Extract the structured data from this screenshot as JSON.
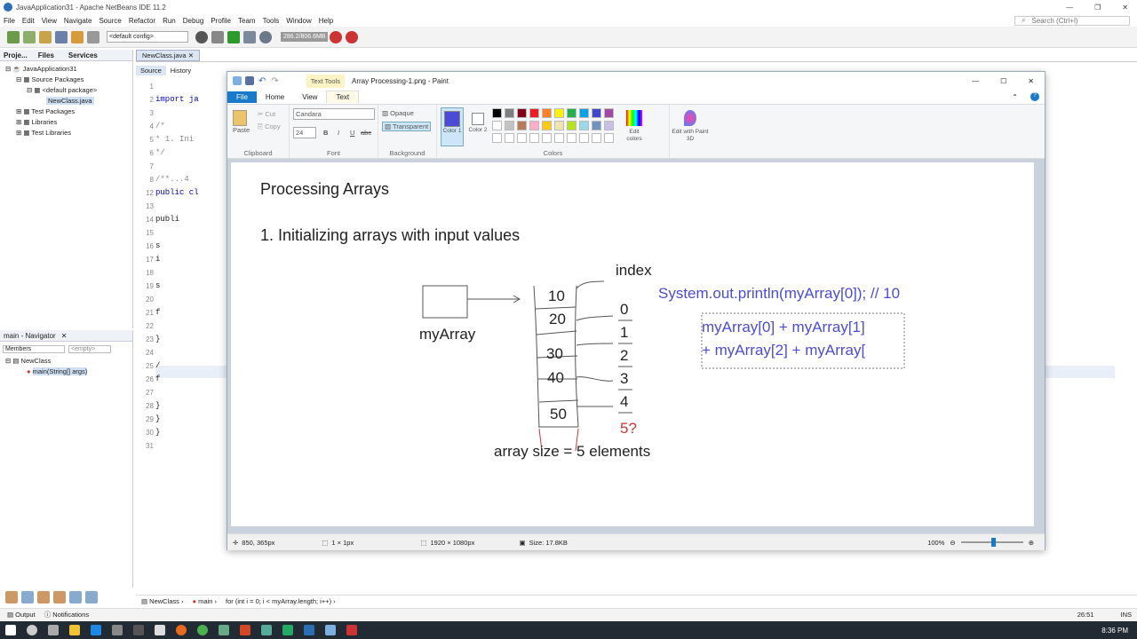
{
  "netbeans": {
    "title": "JavaApplication31 - Apache NetBeans IDE 11.2",
    "menu": [
      "File",
      "Edit",
      "View",
      "Navigate",
      "Source",
      "Refactor",
      "Run",
      "Debug",
      "Profile",
      "Team",
      "Tools",
      "Window",
      "Help"
    ],
    "search_placeholder": "Search (Ctrl+I)",
    "config": "<default config>",
    "memory": "286.2/806.6MB",
    "projects_tabs": [
      "Proje...",
      "Files",
      "Services"
    ],
    "tree": [
      "JavaApplication31",
      "Source Packages",
      "<default package>",
      "NewClass.java",
      "Test Packages",
      "Libraries",
      "Test Libraries"
    ],
    "navigator_title": "main - Navigator",
    "navigator_members": "Members",
    "navigator_empty": "<empty>",
    "navigator_items": [
      "NewClass",
      "main(String[] args)"
    ],
    "editor_tab": "NewClass.java",
    "editor_subtabs": [
      "Source",
      "History"
    ],
    "line_numbers": [
      "1",
      "2",
      "3",
      "4",
      "5",
      "6",
      "7",
      "8",
      "12",
      "13",
      "14",
      "15",
      "16",
      "17",
      "18",
      "19",
      "20",
      "21",
      "22",
      "23",
      "24",
      "25",
      "26",
      "27",
      "28",
      "29",
      "30",
      "31"
    ],
    "code_lines": [
      "",
      "import ja",
      "",
      "/*",
      " * 1. Ini",
      " */",
      "",
      "/**...4",
      "public cl",
      "",
      "    publi",
      "",
      "        s",
      "        i",
      "",
      "        s",
      "",
      "        f",
      "",
      "        }",
      "",
      "        /",
      "        f",
      "",
      "        }",
      "    }",
      "}",
      ""
    ],
    "breadcrumb": [
      "NewClass",
      "main",
      "for (int i = 0; i < myArray.length; i++)"
    ],
    "status_output": "Output",
    "status_notifications": "Notifications",
    "cursor_pos": "26:51",
    "ins": "INS",
    "clock": "8:36 PM"
  },
  "paint": {
    "title": "Array Processing-1.png - Paint",
    "context_tab": "Text Tools",
    "tabs": [
      "File",
      "Home",
      "View",
      "Text"
    ],
    "clipboard": {
      "paste": "Paste",
      "cut": "Cut",
      "copy": "Copy",
      "label": "Clipboard"
    },
    "font": {
      "family": "Candara",
      "size": "24",
      "label": "Font",
      "bold": "B",
      "italic": "I",
      "underline": "U",
      "strike": "abc"
    },
    "background": {
      "opaque": "Opaque",
      "transparent": "Transparent",
      "label": "Background"
    },
    "colors": {
      "color1": "Color 1",
      "color2": "Color 2",
      "label": "Colors",
      "edit": "Edit colors",
      "edit3d": "Edit with Paint 3D",
      "palette": [
        "#000000",
        "#7f7f7f",
        "#880015",
        "#ed1c24",
        "#ff7f27",
        "#fff200",
        "#22b14c",
        "#00a2e8",
        "#3f48cc",
        "#a349a4",
        "#ffffff",
        "#c3c3c3",
        "#b97a57",
        "#ffaec9",
        "#ffc90e",
        "#efe4b0",
        "#b5e61d",
        "#99d9ea",
        "#7092be",
        "#c8bfe7"
      ],
      "selected": "#4b4bd6"
    },
    "status": {
      "pos": "850, 365px",
      "sel": "1 × 1px",
      "dims": "1920 × 1080px",
      "size": "Size: 17.8KB",
      "zoom": "100%"
    },
    "canvas": {
      "heading": "Processing Arrays",
      "subheading": "1. Initializing arrays with input values",
      "var": "myArray",
      "index_label": "index",
      "values": [
        "10",
        "20",
        "30",
        "40",
        "50"
      ],
      "indices": [
        "0",
        "1",
        "2",
        "3",
        "4"
      ],
      "extra_index": "5?",
      "size_note": "array size = 5 elements",
      "println": "System.out.println(myArray[0]); // 10",
      "text_line1": "myArray[0] + myArray[1]",
      "text_line2": "+ myArray[2] + myArray["
    }
  }
}
